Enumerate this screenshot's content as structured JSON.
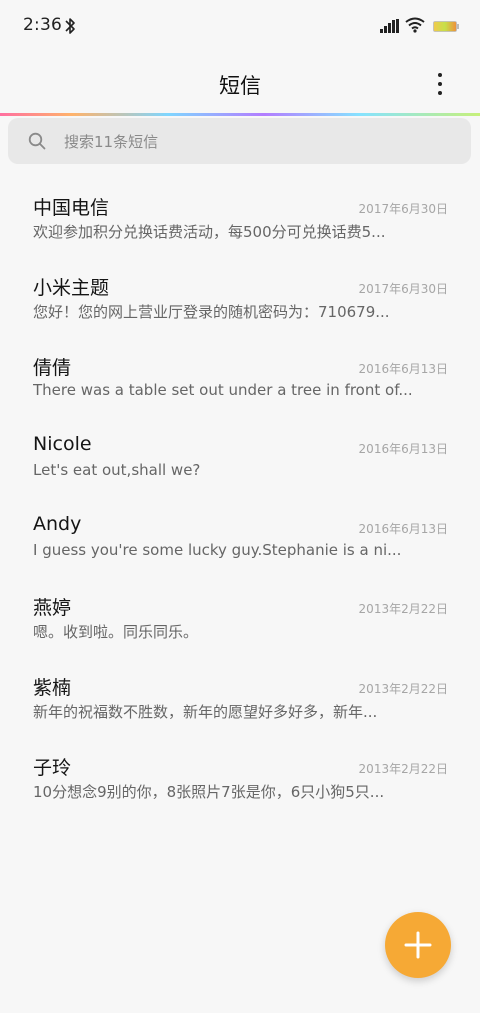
{
  "status": {
    "time": "2:36",
    "icons": [
      "bluetooth-icon",
      "signal-icon",
      "wifi-icon",
      "battery-icon"
    ]
  },
  "header": {
    "title": "短信",
    "more_icon": "more-vertical-icon"
  },
  "search": {
    "placeholder": "搜索11条短信",
    "icon": "search-icon"
  },
  "conversations": [
    {
      "name": "中国电信",
      "date": "2017年6月30日",
      "preview": "欢迎参加积分兑换话费活动，每500分可兑换话费5..."
    },
    {
      "name": "小米主题",
      "date": "2017年6月30日",
      "preview": "您好！您的网上营业厅登录的随机密码为：710679..."
    },
    {
      "name": "倩倩",
      "date": "2016年6月13日",
      "preview": "There was a table set out under a tree in front of..."
    },
    {
      "name": "Nicole",
      "date": "2016年6月13日",
      "preview": "Let's eat out,shall we?"
    },
    {
      "name": "Andy",
      "date": "2016年6月13日",
      "preview": "I guess you're some lucky guy.Stephanie is a ni..."
    },
    {
      "name": "燕婷",
      "date": "2013年2月22日",
      "preview": "嗯。收到啦。同乐同乐。"
    },
    {
      "name": "紫楠",
      "date": "2013年2月22日",
      "preview": "新年的祝福数不胜数，新年的愿望好多好多，新年..."
    },
    {
      "name": "子玲",
      "date": "2013年2月22日",
      "preview": "10分想念9别的你，8张照片7张是你，6只小狗5只..."
    }
  ],
  "fab": {
    "icon": "plus-icon"
  },
  "colors": {
    "accent": "#f6a935",
    "background": "#f7f7f7"
  }
}
